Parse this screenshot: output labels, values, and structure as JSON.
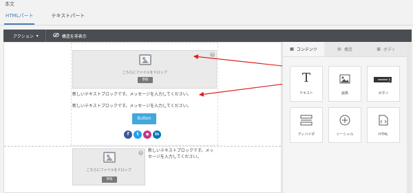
{
  "header": {
    "section_title": "本文",
    "tabs": [
      {
        "label": "HTMLパート",
        "active": true
      },
      {
        "label": "テキストパート",
        "active": false
      }
    ]
  },
  "toolbar": {
    "action_label": "アクション",
    "hide_structure_label": "構造を非表示"
  },
  "editor": {
    "drop_text": "こちらにファイルをドロップ",
    "browse_label": "参照",
    "text_line_1": "新しいテキストブロックです。メッセージを入力してください。",
    "text_line_2": "新しいテキストブロックです。メッセージを入力してください。",
    "button_label": "Button",
    "bottom_text": "新しいテキストブロックです。メッセージを入力してください。",
    "social_icons": [
      "facebook-icon",
      "twitter-icon",
      "instagram-icon",
      "linkedin-icon"
    ]
  },
  "panel": {
    "tabs": [
      {
        "label": "コンテンツ",
        "active": true
      },
      {
        "label": "構造",
        "active": false
      },
      {
        "label": "ボディ",
        "active": false
      }
    ],
    "items": [
      {
        "label": "テキスト",
        "icon": "text-icon"
      },
      {
        "label": "画像",
        "icon": "image-icon"
      },
      {
        "label": "ボタン",
        "icon": "button-icon"
      },
      {
        "label": "ディバイダ",
        "icon": "divider-icon"
      },
      {
        "label": "ソーシャル",
        "icon": "social-icon"
      },
      {
        "label": "HTML",
        "icon": "html-icon"
      }
    ]
  },
  "colors": {
    "accent": "#4a7bb0",
    "toolbar": "#4a4d52",
    "button_blue": "#42a8dc",
    "arrow_red": "#e02020"
  }
}
